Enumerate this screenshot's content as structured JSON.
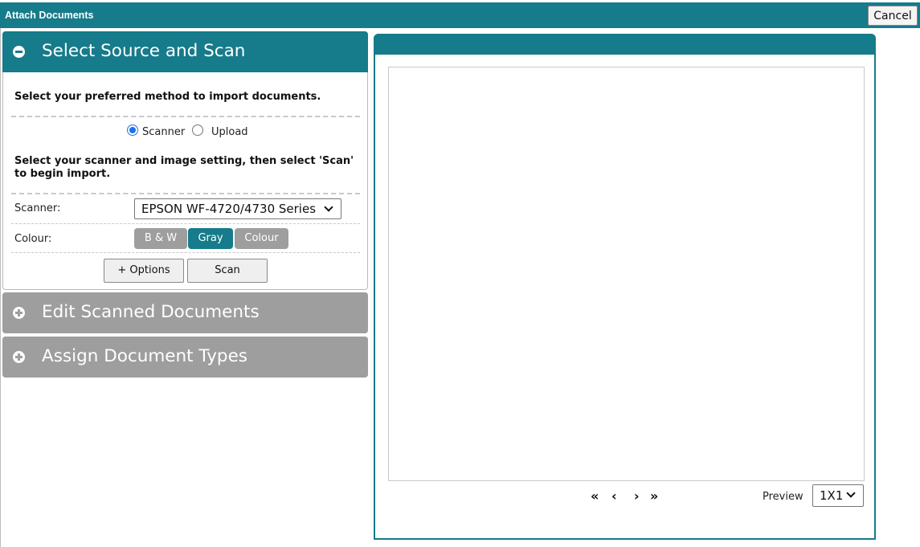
{
  "window": {
    "title": "Attach Documents",
    "cancel_label": "Cancel"
  },
  "panels": [
    {
      "title": "Select Source and Scan",
      "expanded": true,
      "icon": "minus-circle-icon"
    },
    {
      "title": "Edit Scanned Documents",
      "expanded": false,
      "icon": "plus-circle-icon"
    },
    {
      "title": "Assign Document Types",
      "expanded": false,
      "icon": "plus-circle-icon"
    }
  ],
  "source": {
    "instruction": "Select your preferred method to import documents.",
    "options": [
      {
        "label": "Scanner",
        "selected": true
      },
      {
        "label": "Upload",
        "selected": false
      }
    ]
  },
  "scan": {
    "instruction": "Select your scanner and image setting, then select 'Scan' to begin import.",
    "scanner_label": "Scanner:",
    "scanner_value": "EPSON WF-4720/4730 Series",
    "colour_label": "Colour:",
    "colour_modes": [
      {
        "label": "B & W",
        "active": false
      },
      {
        "label": "Gray",
        "active": true
      },
      {
        "label": "Colour",
        "active": false
      }
    ],
    "options_button": "+ Options",
    "scan_button": "Scan"
  },
  "preview": {
    "nav_first": "«",
    "nav_prev": "‹",
    "nav_next": "›",
    "nav_last": "»",
    "label": "Preview",
    "layout_value": "1X1"
  },
  "colors": {
    "accent": "#167b8a",
    "collapsed": "#9e9e9e",
    "radio": "#1a73e8"
  }
}
